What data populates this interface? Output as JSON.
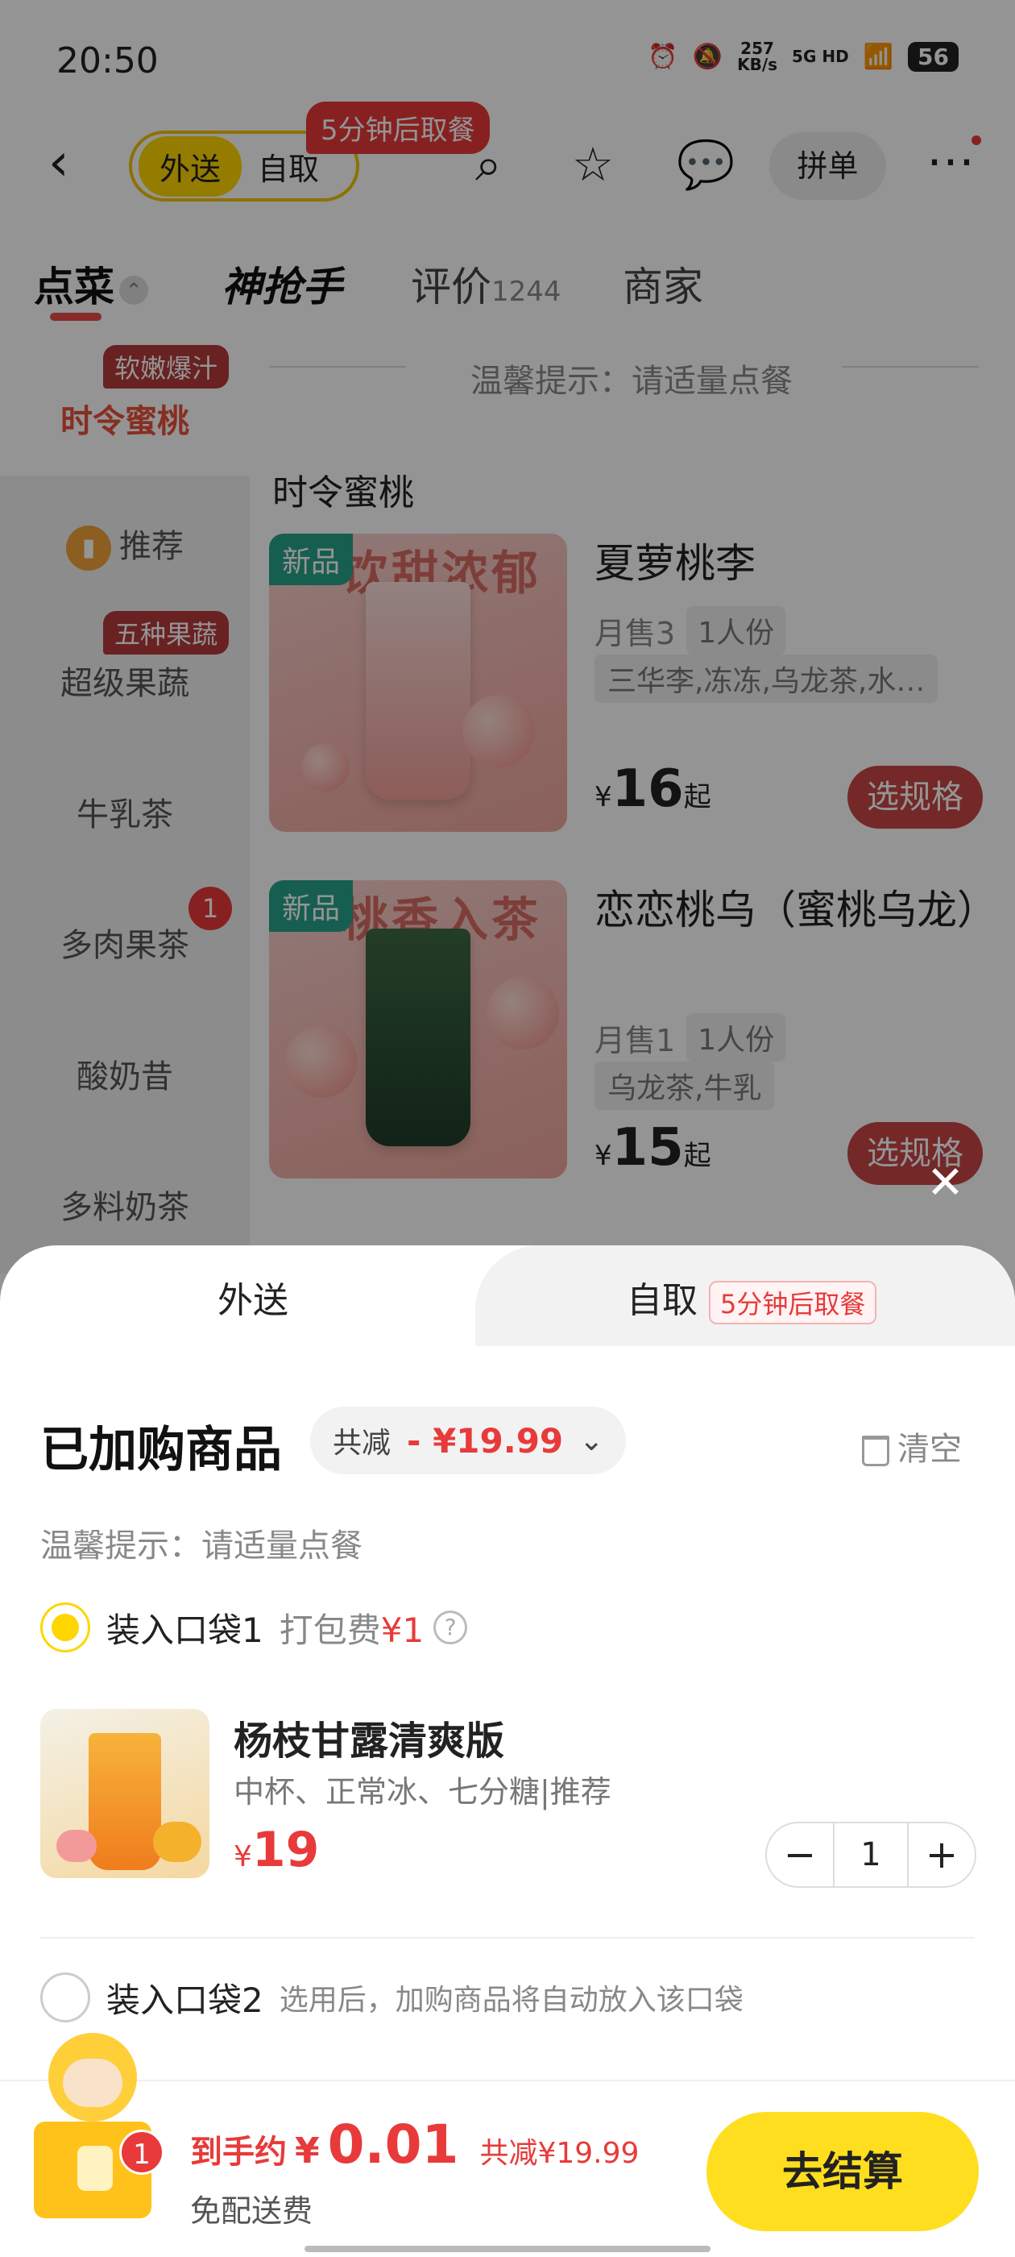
{
  "status_bar": {
    "time": "20:50",
    "net_speed": "257",
    "net_unit": "KB/s",
    "signal": "5G HD",
    "battery": "56"
  },
  "header": {
    "mode_delivery": "外送",
    "mode_pickup": "自取",
    "pickup_tag": "5分钟后取餐",
    "group_order": "拼单"
  },
  "tabs": {
    "order": "点菜",
    "brand": "神抢手",
    "reviews": "评价",
    "reviews_count": "1244",
    "merchant": "商家"
  },
  "sidebar": {
    "active_tag": "软嫩爆汁",
    "active_label": "时令蜜桃",
    "items": [
      {
        "label": "推荐"
      },
      {
        "label": "超级果蔬",
        "tag": "五种果蔬"
      },
      {
        "label": "牛乳茶"
      },
      {
        "label": "多肉果茶",
        "badge": "1"
      },
      {
        "label": "酸奶昔"
      },
      {
        "label": "多料奶茶"
      }
    ]
  },
  "menu": {
    "hint": "温馨提示：请适量点餐",
    "section_title": "时令蜜桃",
    "products": [
      {
        "tag": "新品",
        "image_text": "饮甜浓郁",
        "name": "夏萝桃李",
        "sales": "月售3",
        "portion": "1人份",
        "ingredients": "三华李,冻冻,乌龙茶,水…",
        "currency": "¥",
        "price": "16",
        "price_suffix": "起",
        "button": "选规格"
      },
      {
        "tag": "新品",
        "image_text": "桃香入茶",
        "name": "恋恋桃乌（蜜桃乌龙）",
        "sales": "月售1",
        "portion": "1人份",
        "ingredients": "乌龙茶,牛乳",
        "currency": "¥",
        "price": "15",
        "price_suffix": "起",
        "button": "选规格"
      }
    ]
  },
  "sheet": {
    "tab_delivery": "外送",
    "tab_pickup": "自取",
    "tab_pickup_tag": "5分钟后取餐",
    "title": "已加购商品",
    "discount_label": "共减",
    "discount_amount": "- ¥19.99",
    "clear": "清空",
    "hint": "温馨提示：请适量点餐",
    "bag1_label": "装入口袋1",
    "bag1_fee_label": "打包费",
    "bag1_fee": "¥1",
    "item": {
      "name": "杨枝甘露清爽版",
      "spec": "中杯、正常冰、七分糖|推荐",
      "currency": "¥",
      "price": "19",
      "quantity": "1"
    },
    "bag2_label": "装入口袋2",
    "bag2_desc": "选用后，加购商品将自动放入该口袋"
  },
  "checkout": {
    "cart_count": "1",
    "total_label": "到手约",
    "currency": "¥",
    "total": "0.01",
    "saved": "共减¥19.99",
    "delivery_note": "免配送费",
    "button": "去结算"
  },
  "colors": {
    "brand_yellow": "#ffd600",
    "accent_red": "#e83a3a",
    "spec_button": "#c84545",
    "new_tag": "#27a38a"
  }
}
